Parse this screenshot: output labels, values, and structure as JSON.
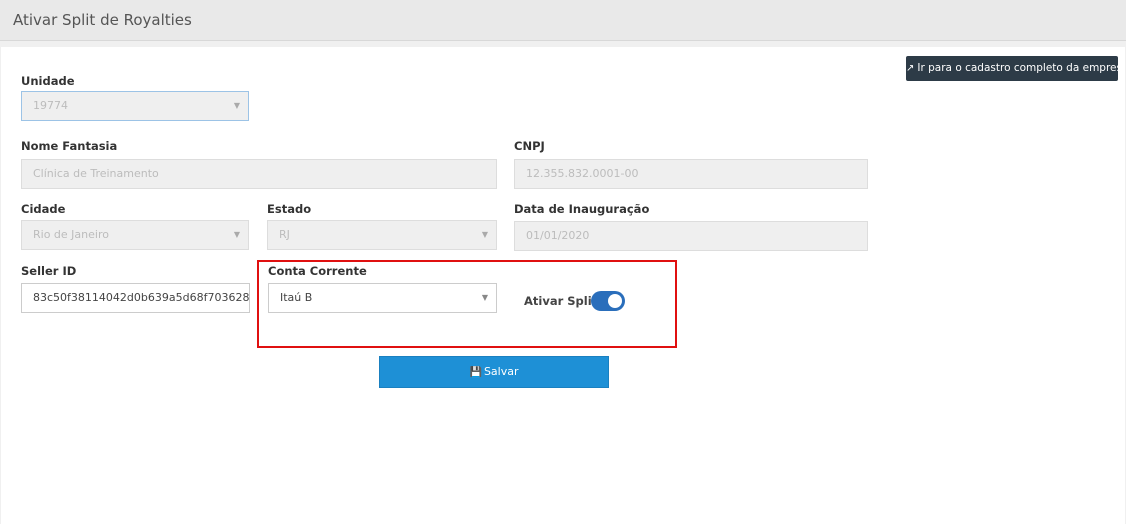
{
  "header": {
    "title": "Ativar Split de Royalties"
  },
  "actions": {
    "external_label": "Ir para o cadastro completo da empresa",
    "save_label": "Salvar"
  },
  "form": {
    "unidade": {
      "label": "Unidade",
      "value": "19774"
    },
    "nome_fantasia": {
      "label": "Nome Fantasia",
      "value": "Clínica de Treinamento"
    },
    "cnpj": {
      "label": "CNPJ",
      "value": "12.355.832.0001-00"
    },
    "cidade": {
      "label": "Cidade",
      "value": "Rio de Janeiro"
    },
    "estado": {
      "label": "Estado",
      "value": "RJ"
    },
    "data_inauguracao": {
      "label": "Data de Inauguração",
      "value": "01/01/2020"
    },
    "seller_id": {
      "label": "Seller ID",
      "value": "83c50f38114042d0b639a5d68f703628"
    },
    "conta_corrente": {
      "label": "Conta Corrente",
      "value": "Itaú B"
    },
    "ativar_split": {
      "label": "Ativar Split",
      "enabled": true
    }
  },
  "icons": {
    "external": "external-link-icon",
    "save": "floppy-disk-icon",
    "caret": "caret-down-icon"
  },
  "colors": {
    "accent": "#1e90d6",
    "toggle_on": "#2a6ebb",
    "highlight": "#e01010",
    "dark_button": "#2d3b47"
  }
}
